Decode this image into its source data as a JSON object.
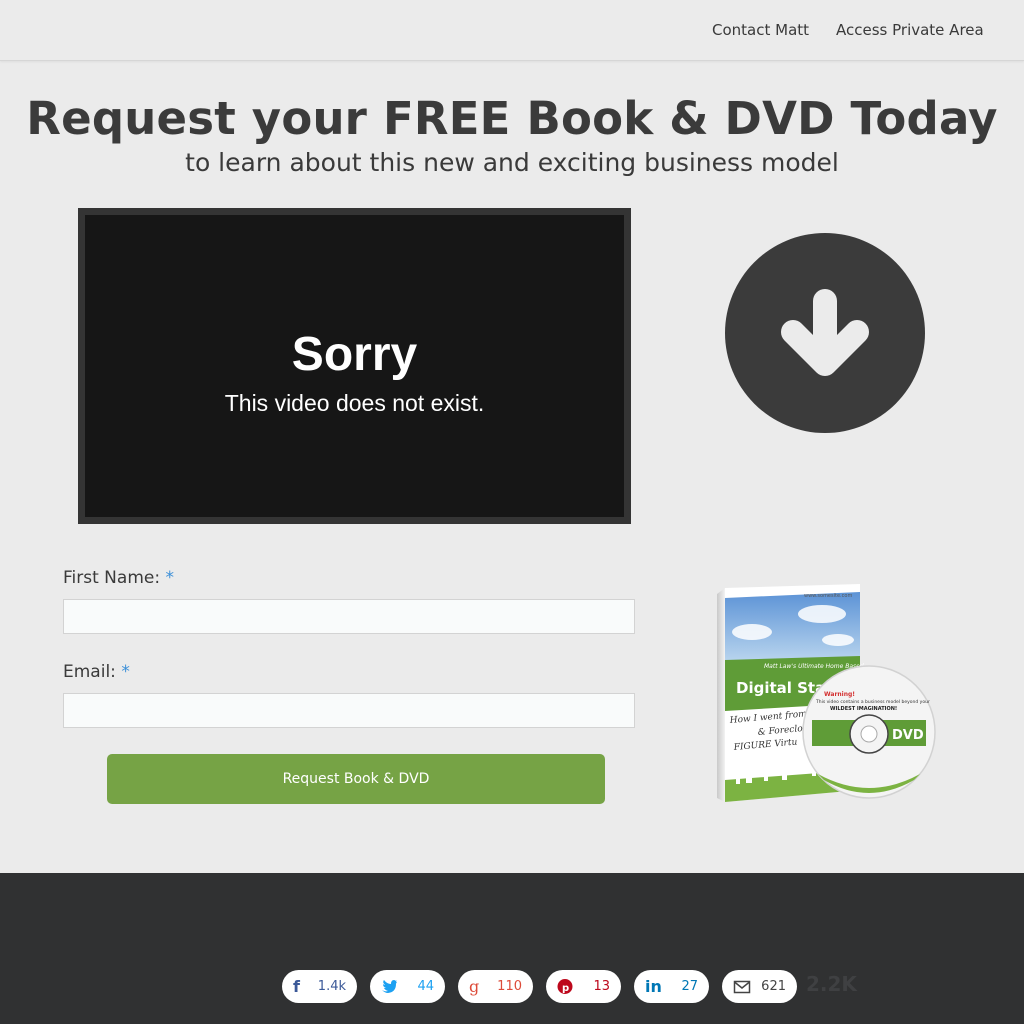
{
  "nav": {
    "contact_label": "Contact Matt",
    "private_label": "Access Private Area"
  },
  "hero": {
    "headline": "Request your FREE Book & DVD Today",
    "subheadline": "to learn about this new and exciting business model"
  },
  "video": {
    "error_title": "Sorry",
    "error_message": "This video does not exist."
  },
  "download_icon": "arrow-down-icon",
  "form": {
    "first_name_label": "First Name:",
    "email_label": "Email:",
    "required_mark": "*",
    "first_name_value": "",
    "email_value": "",
    "submit_label": "Request Book & DVD"
  },
  "product": {
    "brand_line": "Matt Law's Ultimate Home Based",
    "title": "Digital Start-U",
    "subtitle_1": "How I went from 7",
    "subtitle_2": "& Foreclosure",
    "subtitle_3": "FIGURE Virtu",
    "url": "www.somesite.com",
    "disc_warning_title": "Warning!",
    "disc_warning_text": "This video contains a business model beyond your",
    "disc_warning_emph": "WILDEST IMAGINATION!",
    "disc_label": "DVD"
  },
  "share": {
    "facebook": {
      "icon": "facebook-icon",
      "count": "1.4k"
    },
    "twitter": {
      "icon": "twitter-icon",
      "count": "44"
    },
    "googleplus": {
      "icon": "google-plus-icon",
      "count": "110"
    },
    "pinterest": {
      "icon": "pinterest-icon",
      "count": "13"
    },
    "linkedin": {
      "icon": "linkedin-icon",
      "count": "27"
    },
    "email": {
      "icon": "mail-icon",
      "count": "621"
    },
    "total": "2.2K"
  },
  "colors": {
    "button_green": "#76a345",
    "required_blue": "#3b8fd8",
    "footer_dark": "#303132",
    "circle_dark": "#3b3b3b"
  }
}
